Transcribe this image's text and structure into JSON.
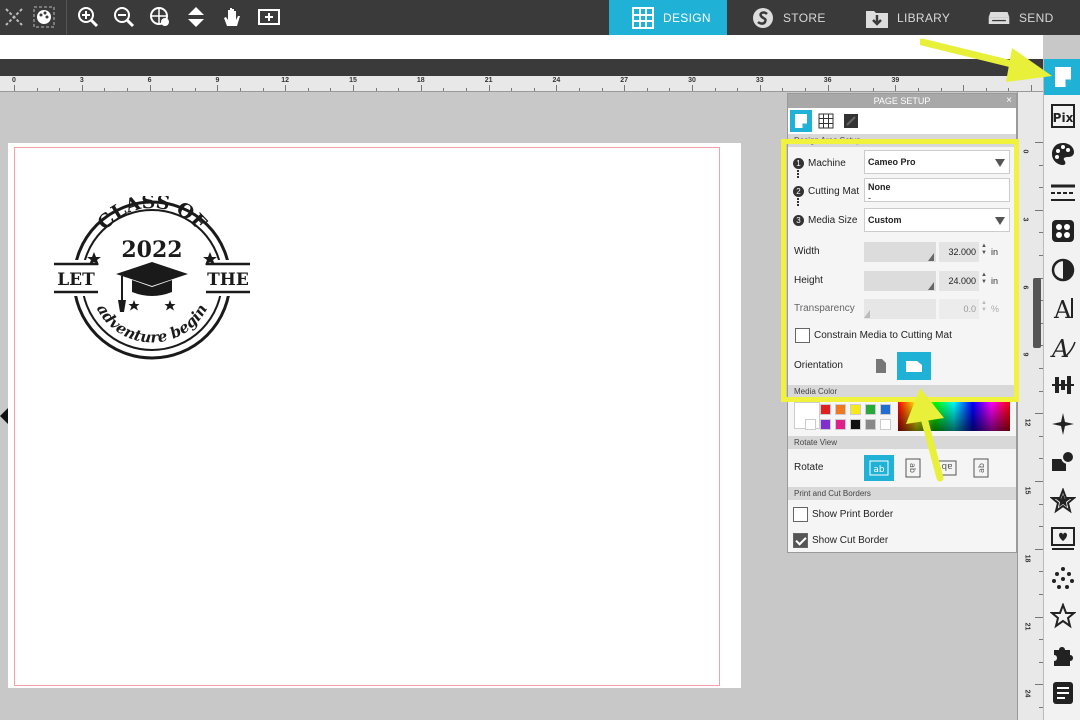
{
  "nav": {
    "tabs": [
      {
        "label": "DESIGN",
        "icon": "design-grid-icon",
        "active": true
      },
      {
        "label": "STORE",
        "icon": "silhouette-s-icon",
        "active": false
      },
      {
        "label": "LIBRARY",
        "icon": "library-download-icon",
        "active": false
      },
      {
        "label": "SEND",
        "icon": "cutter-machine-icon",
        "active": false
      }
    ]
  },
  "toolbar": {
    "icons": [
      "close-icon",
      "palette-icon",
      "zoom-in-icon",
      "zoom-out-icon",
      "zoom-select-icon",
      "move-down-icon",
      "pan-hand-icon",
      "fit-to-page-icon"
    ]
  },
  "ruler": {
    "h_labels": [
      "0",
      "3",
      "6",
      "9",
      "12",
      "15",
      "18",
      "21",
      "24",
      "27",
      "30",
      "33",
      "36",
      "39"
    ],
    "v_labels": [
      "0",
      "3",
      "6",
      "9",
      "12",
      "15",
      "18",
      "21",
      "24"
    ]
  },
  "design": {
    "top_arc": "CLASS OF",
    "year": "2022",
    "left_word": "LET",
    "right_word": "THE",
    "script_text": "adventure begin"
  },
  "panel": {
    "title": "PAGE SETUP",
    "close": "×",
    "section_design_area": "Design Area Setup",
    "machine_label": "Machine",
    "machine_value": "Cameo Pro",
    "mat_label": "Cutting Mat",
    "mat_value": "None",
    "mat_sub": "-",
    "media_label": "Media Size",
    "media_value": "Custom",
    "width_label": "Width",
    "width_value": "32.000",
    "width_unit": "in",
    "height_label": "Height",
    "height_value": "24.000",
    "height_unit": "in",
    "transparency_label": "Transparency",
    "transparency_value": "0.0",
    "transparency_unit": "%",
    "constrain_label": "Constrain Media to Cutting Mat",
    "constrain_checked": false,
    "orientation_label": "Orientation",
    "orientation_selected": "landscape",
    "section_media_color": "Media Color",
    "swatches": [
      "#ffffff",
      "#e02020",
      "#f07820",
      "#f8e818",
      "#28a838",
      "#1f6fd0",
      "#ffffff",
      "#8030d0",
      "#e0208a",
      "#111111",
      "#888888",
      "#ffffff"
    ],
    "section_rotate_view": "Rotate View",
    "rotate_label": "Rotate",
    "section_borders": "Print and Cut Borders",
    "show_print_border_label": "Show Print Border",
    "show_print_border_checked": false,
    "show_cut_border_label": "Show Cut Border",
    "show_cut_border_checked": true
  },
  "rtools": {
    "icons": [
      "page-setup-icon",
      "pixscan-icon",
      "fill-color-icon",
      "line-style-icon",
      "image-effects-icon",
      "fill-contrast-icon",
      "text-style-icon",
      "sketch-text-icon",
      "align-icon",
      "replicate-icon",
      "modify-icon",
      "offset-icon",
      "trace-icon",
      "image-effects-2-icon",
      "star-shape-icon",
      "puzzle-icon",
      "library-text-icon"
    ]
  },
  "colors": {
    "accent": "#1fb2d6",
    "highlight": "#f0f23c",
    "toolbar_bg": "#3a3a3a"
  }
}
